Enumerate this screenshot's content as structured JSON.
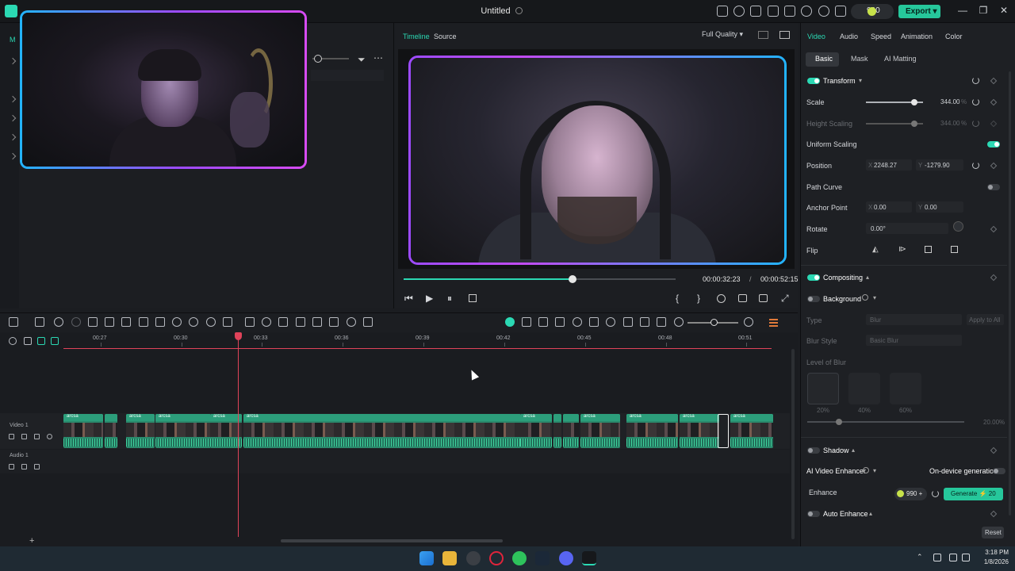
{
  "titlebar": {
    "title": "Untitled",
    "credits": "990",
    "export_label": "Export",
    "window_controls": [
      "—",
      "❐",
      "✕"
    ]
  },
  "media": {
    "tab_label": "M"
  },
  "player": {
    "tabs": [
      "Timeline",
      "Source"
    ],
    "quality": "Full Quality",
    "current_time": "00:00:32:23",
    "separator": "/",
    "total_time": "00:00:52:15",
    "progress_fraction": 0.62
  },
  "right_panel": {
    "tabs": [
      "Video",
      "Audio",
      "Speed",
      "Animation",
      "Color"
    ],
    "subtabs": [
      "Basic",
      "Mask",
      "AI Matting"
    ],
    "transform": {
      "title": "Transform",
      "scale_label": "Scale",
      "scale_value": "344.00",
      "scale_unit": "%",
      "scale_fraction": 0.85,
      "height_scaling_label": "Height Scaling",
      "height_scaling_value": "344.00",
      "height_scaling_unit": "%",
      "uniform_scaling_label": "Uniform Scaling",
      "position_label": "Position",
      "position_x_axis": "X",
      "position_x": "2248.27",
      "position_y_axis": "Y",
      "position_y": "-1279.90",
      "path_curve_label": "Path Curve",
      "anchor_label": "Anchor Point",
      "anchor_x_axis": "X",
      "anchor_x": "0.00",
      "anchor_y_axis": "Y",
      "anchor_y": "0.00",
      "rotate_label": "Rotate",
      "rotate_value": "0.00°",
      "flip_label": "Flip"
    },
    "compositing": {
      "title": "Compositing"
    },
    "background": {
      "title": "Background",
      "type_label": "Type",
      "type_value": "Blur",
      "apply_all_label": "Apply to All",
      "blur_style_label": "Blur Style",
      "blur_style_value": "Basic Blur",
      "level_label": "Level of Blur",
      "level_options": [
        "20%",
        "40%",
        "60%"
      ],
      "level_value": "20.00",
      "level_unit": "%",
      "level_fraction": 0.2
    },
    "shadow": {
      "title": "Shadow"
    },
    "ai_enhancer": {
      "title": "AI Video Enhancer",
      "on_device_label": "On-device generation",
      "enhance_label": "Enhance",
      "credits": "990",
      "generate_label": "Generate",
      "generate_cost": "20"
    },
    "auto_enhance": {
      "title": "Auto Enhance"
    },
    "reset_label": "Reset"
  },
  "timeline": {
    "ruler_labels": [
      "00:27",
      "00:30",
      "00:33",
      "00:36",
      "00:39",
      "00:42",
      "00:45",
      "00:48",
      "00:51"
    ],
    "video_track_label": "Video 1",
    "audio_track_label": "Audio 1",
    "clip_name": "arcsa",
    "add_track_label": "+"
  },
  "taskbar": {
    "time": "3:18 PM",
    "date": "1/8/2026"
  },
  "colors": {
    "accent": "#2bd9b4",
    "playhead": "#e0435a",
    "clip": "#2a8a6c"
  }
}
